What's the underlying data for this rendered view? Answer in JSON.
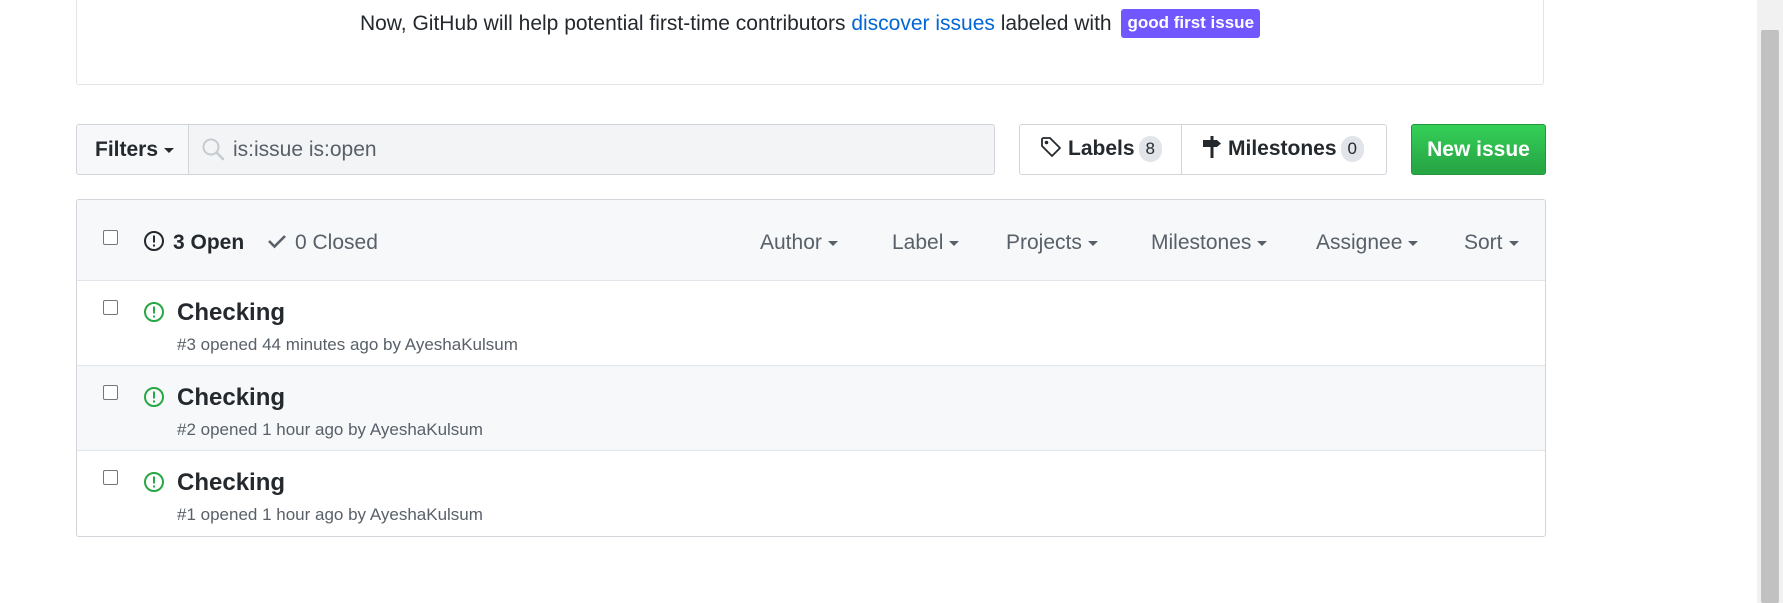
{
  "banner": {
    "text_before": "Now, GitHub will help potential first-time contributors ",
    "link": "discover issues",
    "text_after": " labeled with ",
    "badge": "good first issue",
    "badge_color": "#7057ff"
  },
  "toolbar": {
    "filters_label": "Filters",
    "search_value": "is:issue is:open",
    "labels_label": "Labels",
    "labels_count": "8",
    "milestones_label": "Milestones",
    "milestones_count": "0",
    "new_issue_label": "New issue",
    "accent_green": "#28a745"
  },
  "header": {
    "open_label": "3 Open",
    "closed_label": "0 Closed",
    "filters": [
      "Author",
      "Label",
      "Projects",
      "Milestones",
      "Assignee",
      "Sort"
    ]
  },
  "issues": [
    {
      "title": "Checking",
      "meta_prefix": "#3 opened 44 minutes ago by ",
      "author": "AyeshaKulsum"
    },
    {
      "title": "Checking",
      "meta_prefix": "#2 opened 1 hour ago by ",
      "author": "AyeshaKulsum"
    },
    {
      "title": "Checking",
      "meta_prefix": "#1 opened 1 hour ago by ",
      "author": "AyeshaKulsum"
    }
  ]
}
